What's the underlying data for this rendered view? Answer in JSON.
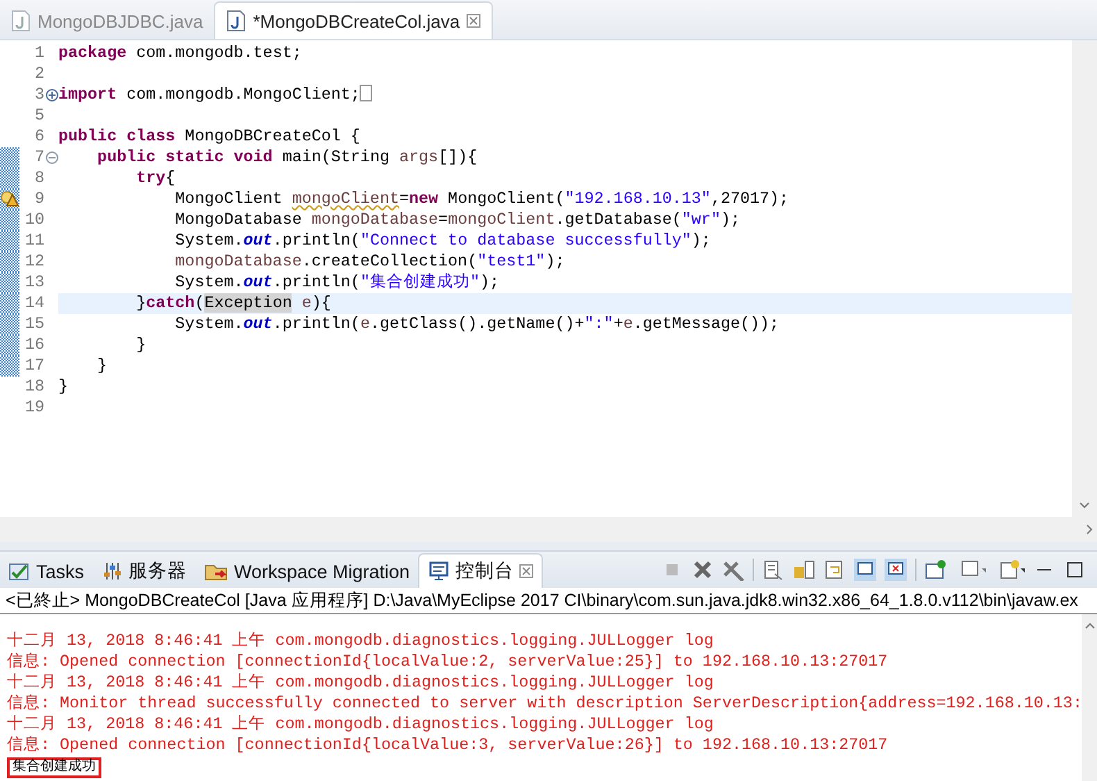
{
  "editor_tabs": [
    {
      "label": "MongoDBJDBC.java",
      "selected": false
    },
    {
      "label": "*MongoDBCreateCol.java",
      "selected": true
    }
  ],
  "code_lines": [
    {
      "number": "1",
      "tokens": [
        {
          "kind": "kw",
          "text": "package"
        },
        {
          "kind": "plain",
          "text": " com.mongodb.test;"
        }
      ]
    },
    {
      "number": "2"
    },
    {
      "number": "3",
      "folded": true,
      "tokens": [
        {
          "kind": "kw",
          "text": "import"
        },
        {
          "kind": "plain",
          "text": " com.mongodb.MongoClient;"
        }
      ]
    },
    {
      "number": "5"
    },
    {
      "number": "6",
      "tokens": [
        {
          "kind": "kw",
          "text": "public class"
        },
        {
          "kind": "plain",
          "text": " MongoDBCreateCol {"
        }
      ]
    },
    {
      "number": "7",
      "folded": false,
      "changed": true,
      "tokens": [
        {
          "kind": "kw",
          "text": "    public static void"
        },
        {
          "kind": "plain",
          "text": " main(String "
        },
        {
          "kind": "local",
          "text": "args"
        },
        {
          "kind": "plain",
          "text": "[]){"
        }
      ]
    },
    {
      "number": "8",
      "changed": true,
      "tokens": [
        {
          "kind": "kw",
          "text": "        try"
        },
        {
          "kind": "plain",
          "text": "{"
        }
      ]
    },
    {
      "number": "9",
      "changed": true,
      "warning": true,
      "tokens": [
        {
          "kind": "plain",
          "text": "            MongoClient "
        },
        {
          "kind": "warned",
          "text": "mongoClient"
        },
        {
          "kind": "plain",
          "text": "="
        },
        {
          "kind": "kw",
          "text": "new"
        },
        {
          "kind": "plain",
          "text": " MongoClient("
        },
        {
          "kind": "str",
          "text": "\"192.168.10.13\""
        },
        {
          "kind": "plain",
          "text": ",27017);"
        }
      ]
    },
    {
      "number": "10",
      "changed": true,
      "tokens": [
        {
          "kind": "plain",
          "text": "            MongoDatabase "
        },
        {
          "kind": "local",
          "text": "mongoDatabase"
        },
        {
          "kind": "plain",
          "text": "="
        },
        {
          "kind": "local",
          "text": "mongoClient"
        },
        {
          "kind": "plain",
          "text": ".getDatabase("
        },
        {
          "kind": "str",
          "text": "\"wr\""
        },
        {
          "kind": "plain",
          "text": ");"
        }
      ]
    },
    {
      "number": "11",
      "changed": true,
      "tokens": [
        {
          "kind": "plain",
          "text": "            System."
        },
        {
          "kind": "field",
          "text": "out"
        },
        {
          "kind": "plain",
          "text": ".println("
        },
        {
          "kind": "str",
          "text": "\"Connect to database successfully\""
        },
        {
          "kind": "plain",
          "text": ");"
        }
      ]
    },
    {
      "number": "12",
      "changed": true,
      "tokens": [
        {
          "kind": "local",
          "text": "            mongoDatabase"
        },
        {
          "kind": "plain",
          "text": ".createCollection("
        },
        {
          "kind": "str",
          "text": "\"test1\""
        },
        {
          "kind": "plain",
          "text": ");"
        }
      ]
    },
    {
      "number": "13",
      "changed": true,
      "tokens": [
        {
          "kind": "plain",
          "text": "            System."
        },
        {
          "kind": "field",
          "text": "out"
        },
        {
          "kind": "plain",
          "text": ".println("
        },
        {
          "kind": "str",
          "text": "\"集合创建成功\""
        },
        {
          "kind": "plain",
          "text": ");"
        }
      ]
    },
    {
      "number": "14",
      "changed": true,
      "current": true,
      "tokens": [
        {
          "kind": "plain",
          "text": "        }"
        },
        {
          "kind": "kw",
          "text": "catch"
        },
        {
          "kind": "plain",
          "text": "("
        },
        {
          "kind": "occurrence",
          "text": "Exception"
        },
        {
          "kind": "local",
          "text": " e"
        },
        {
          "kind": "plain",
          "text": "){"
        }
      ]
    },
    {
      "number": "15",
      "changed": true,
      "tokens": [
        {
          "kind": "plain",
          "text": "            System."
        },
        {
          "kind": "field",
          "text": "out"
        },
        {
          "kind": "plain",
          "text": ".println("
        },
        {
          "kind": "local",
          "text": "e"
        },
        {
          "kind": "plain",
          "text": ".getClass().getName()+"
        },
        {
          "kind": "str",
          "text": "\":\""
        },
        {
          "kind": "plain",
          "text": "+"
        },
        {
          "kind": "local",
          "text": "e"
        },
        {
          "kind": "plain",
          "text": ".getMessage());"
        }
      ]
    },
    {
      "number": "16",
      "changed": true,
      "tokens": [
        {
          "kind": "plain",
          "text": "        }"
        }
      ]
    },
    {
      "number": "17",
      "changed": true,
      "tokens": [
        {
          "kind": "plain",
          "text": "    }"
        }
      ]
    },
    {
      "number": "18",
      "tokens": [
        {
          "kind": "plain",
          "text": "}"
        }
      ]
    },
    {
      "number": "19"
    }
  ],
  "view_tabs": [
    {
      "label": "Tasks",
      "kind": "tasks",
      "selected": false
    },
    {
      "label": "服务器",
      "kind": "servers",
      "selected": false
    },
    {
      "label": "Workspace Migration",
      "kind": "migration",
      "selected": false
    },
    {
      "label": "控制台",
      "kind": "console",
      "selected": true
    }
  ],
  "console": {
    "process": "<已終止> MongoDBCreateCol [Java 应用程序] D:\\Java\\MyEclipse 2017 CI\\binary\\com.sun.java.jdk8.win32.x86_64_1.8.0.v112\\bin\\javaw.ex",
    "lines": [
      {
        "kind": "err",
        "text": "十二月 13, 2018 8:46:41 上午 com.mongodb.diagnostics.logging.JULLogger log"
      },
      {
        "kind": "err",
        "text": "信息: Opened connection [connectionId{localValue:2, serverValue:25}] to 192.168.10.13:27017"
      },
      {
        "kind": "err",
        "text": "十二月 13, 2018 8:46:41 上午 com.mongodb.diagnostics.logging.JULLogger log"
      },
      {
        "kind": "err",
        "text": "信息: Monitor thread successfully connected to server with description ServerDescription{address=192.168.10.13:"
      },
      {
        "kind": "err",
        "text": "十二月 13, 2018 8:46:41 上午 com.mongodb.diagnostics.logging.JULLogger log"
      },
      {
        "kind": "err",
        "text": "信息: Opened connection [connectionId{localValue:3, serverValue:26}] to 192.168.10.13:27017"
      },
      {
        "kind": "out",
        "text": "集合创建成功",
        "boxed": true
      }
    ]
  }
}
